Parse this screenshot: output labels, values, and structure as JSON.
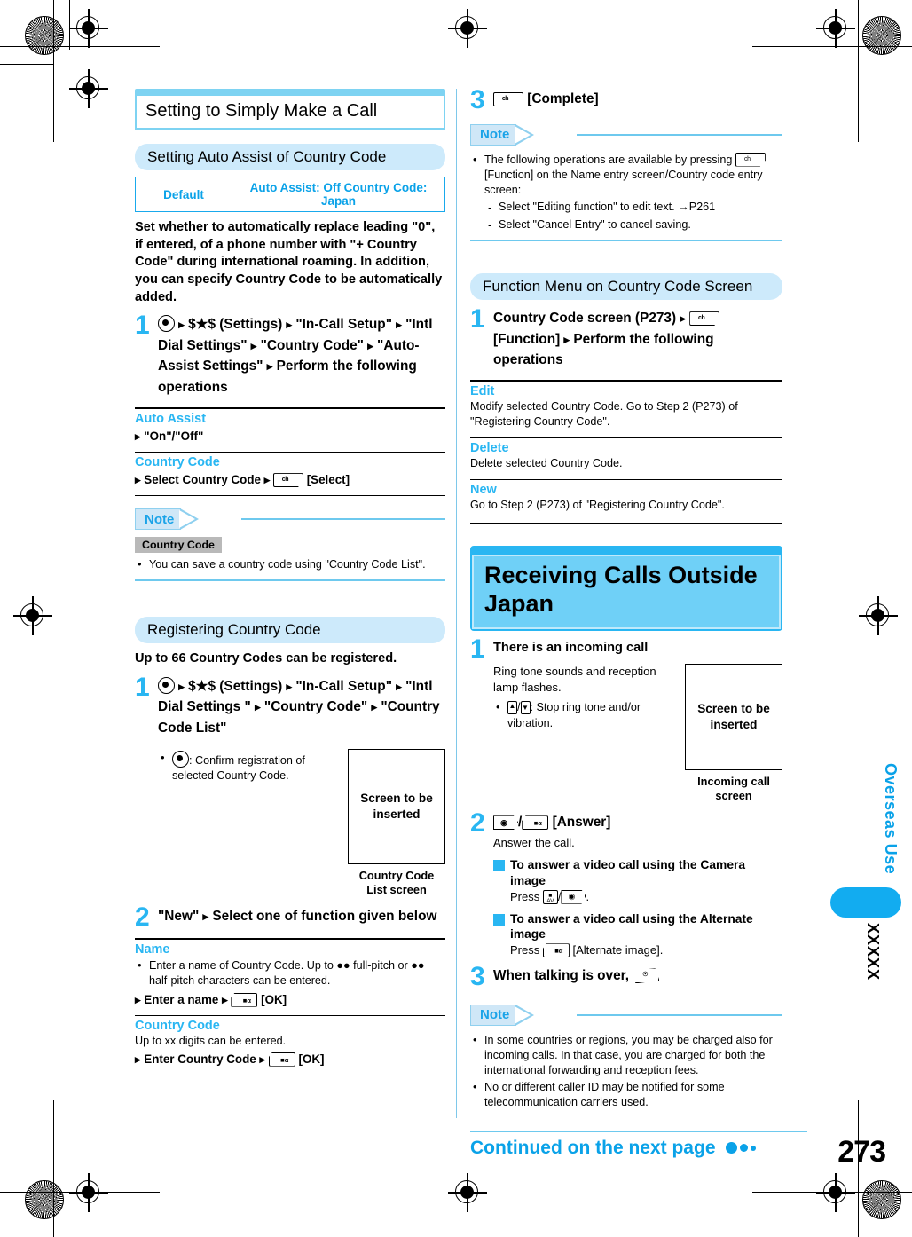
{
  "page": {
    "number": "273",
    "side_tab_label": "Overseas Use",
    "side_tab_code": "XXXXX",
    "continued_text": "Continued on the next page"
  },
  "left_column": {
    "chapter_title": "Setting to Simply Make a Call",
    "section1": {
      "title": "Setting Auto Assist of Country Code",
      "default_table": {
        "label": "Default",
        "value": "Auto Assist: Off   Country Code: Japan"
      },
      "intro": "Set whether to automatically replace leading \"0\", if entered, of a phone number with \"+ Country Code\" during international roaming. In addition, you can specify Country Code to be automatically added.",
      "step1": {
        "num": "1",
        "part1": "(Settings)",
        "menu1": "\"In-Call Setup\"",
        "menu2": "\"Intl Dial Settings\"",
        "menu3": "\"Country Code\"",
        "menu4": "\"Auto-Assist Settings\"",
        "tail": "Perform the following operations",
        "placeholder": "$★$"
      },
      "functions": [
        {
          "name": "Auto Assist",
          "op": "\"On\"/\"Off\""
        },
        {
          "name": "Country Code",
          "op_pre": "Select Country Code",
          "op_post": "[Select]"
        }
      ],
      "note": {
        "head": "Note",
        "chip": "Country Code",
        "items": [
          "You can save a country code using \"Country Code List\"."
        ]
      }
    },
    "section2": {
      "title": "Registering Country Code",
      "intro": "Up to 66 Country Codes can be registered.",
      "step1": {
        "num": "1",
        "part1": "(Settings)",
        "menu1": "\"In-Call Setup\"",
        "menu2": "\"Intl Dial Settings \"",
        "menu3": "\"Country Code\"",
        "menu4": "\"Country Code List\"",
        "bullet": ": Confirm registration of selected Country Code."
      },
      "screen": {
        "placeholder": "Screen to be inserted",
        "caption": "Country Code\nList screen"
      },
      "step2": {
        "num": "2",
        "text": "\"New\"    Select one of function given below"
      },
      "functions": [
        {
          "name": "Name",
          "bullet": "Enter a name of Country Code. Up to ●● full-pitch or ●● half-pitch characters can be entered.",
          "op_pre": "Enter a name",
          "op_post": "[OK]"
        },
        {
          "name": "Country Code",
          "desc": "Up to xx digits can be entered.",
          "op_pre": "Enter Country Code",
          "op_post": "[OK]"
        }
      ]
    }
  },
  "right_column": {
    "step3": {
      "num": "3",
      "label": "[Complete]"
    },
    "note1": {
      "head": "Note",
      "items": [
        "The following operations are available by pressing"
      ],
      "item_tail": "[Function] on the Name entry screen/Country code entry screen:",
      "dashes": [
        "Select \"Editing function\" to edit text. →P261",
        "Select \"Cancel Entry\" to cancel saving."
      ]
    },
    "section_fn": {
      "title": "Function Menu on Country Code Screen",
      "step1": {
        "num": "1",
        "pre": "Country Code screen (P273)",
        "mid": "[Function]",
        "tail": "Perform the following operations"
      },
      "functions": [
        {
          "name": "Edit",
          "desc": "Modify selected Country Code. Go to Step 2 (P273) of \"Registering Country Code\"."
        },
        {
          "name": "Delete",
          "desc": "Delete selected Country Code."
        },
        {
          "name": "New",
          "desc": "Go to Step 2 (P273) of \"Registering Country Code\"."
        }
      ]
    },
    "chapter2": {
      "title": "Receiving Calls Outside Japan",
      "step1": {
        "num": "1",
        "heading": "There is an incoming call",
        "desc": "Ring tone sounds and reception lamp flashes.",
        "bullet": ": Stop ring tone and/or vibration."
      },
      "screen": {
        "placeholder": "Screen to be inserted",
        "caption": "Incoming call\nscreen"
      },
      "step2": {
        "num": "2",
        "label": "[Answer]",
        "desc": "Answer the call.",
        "sub1_head": "To answer a video call using the Camera image",
        "sub1_press": "Press",
        "sub2_head": "To answer a video call using the Alternate image",
        "sub2_press": "Press",
        "sub2_tail": "[Alternate image]."
      },
      "step3": {
        "num": "3",
        "text": "When talking is over,"
      },
      "note": {
        "head": "Note",
        "items": [
          "In some countries or regions, you may be charged also for incoming calls. In that case, you are charged for both the international forwarding and reception fees.",
          "No or different caller ID may be notified for some telecommunication carriers used."
        ]
      }
    }
  },
  "colors": {
    "accent_cyan": "#0aa2e8",
    "pill_bg": "#cdeafb",
    "chapter_band": "#7ed3f2",
    "chapter_big": "#6fd0f7",
    "note_line": "#6ec9ee"
  }
}
